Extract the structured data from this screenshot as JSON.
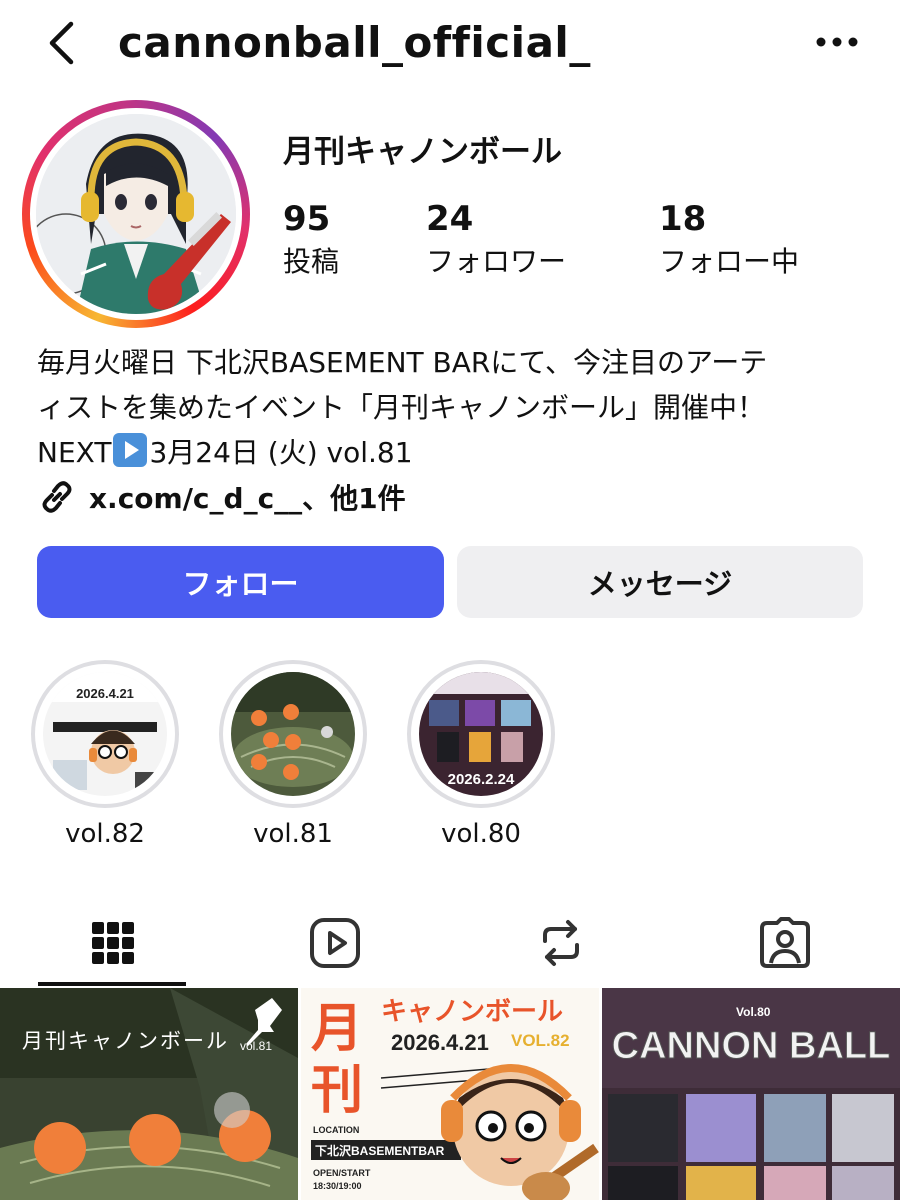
{
  "header": {
    "username": "cannonball_official_",
    "back_icon": "chevron-left-icon",
    "more_icon": "more-horizontal-icon"
  },
  "profile": {
    "display_name": "月刊キャノンボール",
    "stats": [
      {
        "value": "95",
        "label": "投稿"
      },
      {
        "value": "24",
        "label": "フォロワー"
      },
      {
        "value": "18",
        "label": "フォロー中"
      }
    ],
    "bio": {
      "line1": "毎月火曜日 下北沢BASEMENT BARにて、今注目のアーテ",
      "line2": "ィストを集めたイベント「月刊キャノンボール」開催中！",
      "line3_prefix": "NEXT",
      "line3_suffix": "3月24日 (火) vol.81"
    },
    "link": "x.com/c_d_c__、他1件"
  },
  "actions": {
    "follow_label": "フォロー",
    "message_label": "メッセージ",
    "follow_color": "#4a5cf0"
  },
  "highlights": [
    {
      "label": "vol.82",
      "image_text": "2026.4.21"
    },
    {
      "label": "vol.81"
    },
    {
      "label": "vol.80",
      "image_text": "2026.2.24"
    }
  ],
  "tabs": [
    {
      "icon": "grid-icon",
      "active": true
    },
    {
      "icon": "reels-icon"
    },
    {
      "icon": "reposts-icon"
    },
    {
      "icon": "tagged-icon"
    }
  ],
  "posts": [
    {
      "title": "月刊キャノンボール",
      "sub": "vol.81",
      "pinned": true
    },
    {
      "kanji1": "月",
      "kanji2": "刊",
      "headline": "キャノンボール",
      "date": "2026.4.21",
      "vol": "VOL.82",
      "location_label": "LOCATION",
      "venue": "下北沢BASEMENTBAR",
      "open_label": "OPEN/START",
      "open_time": "18:30/19:00"
    },
    {
      "title": "CANNON BALL",
      "vol": "Vol.80"
    }
  ]
}
